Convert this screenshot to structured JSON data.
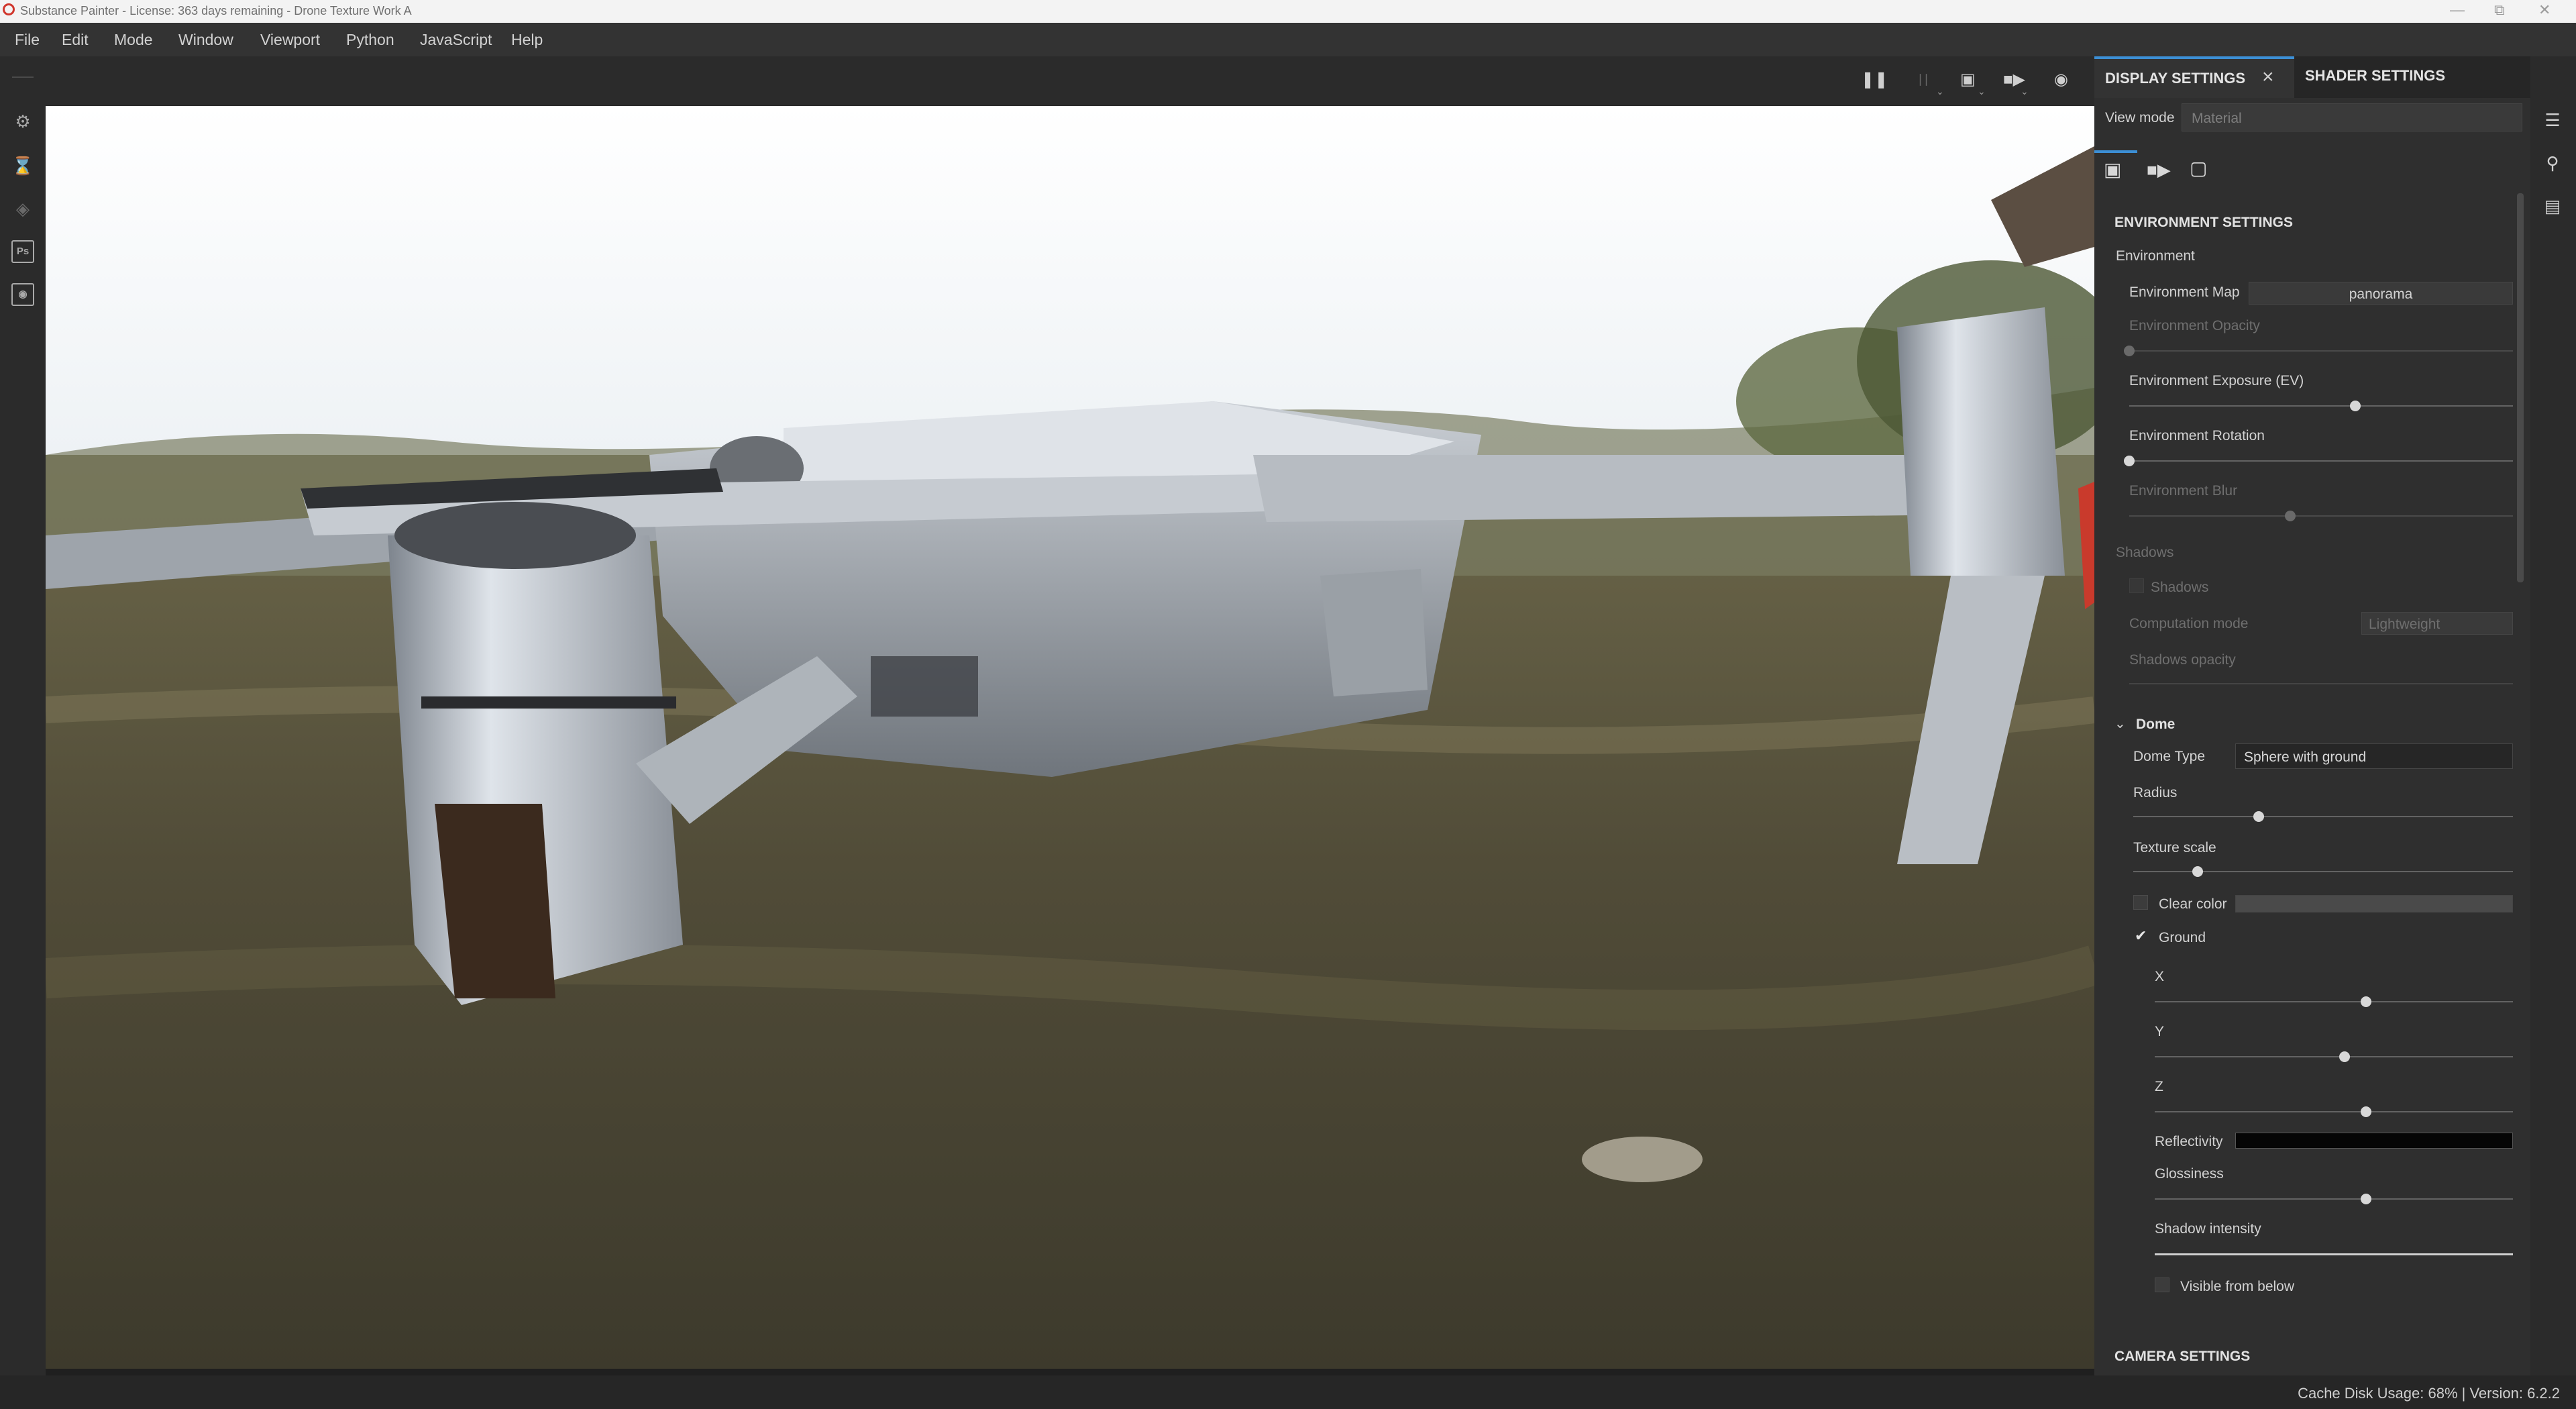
{
  "window": {
    "title": "Substance Painter - License: 363 days remaining - Drone Texture Work A"
  },
  "menu": [
    "File",
    "Edit",
    "Mode",
    "Window",
    "Viewport",
    "Python",
    "JavaScript",
    "Help"
  ],
  "viewport_toolbar": {
    "icons": [
      "pause-icon",
      "symmetry-icon",
      "cube-icon",
      "camera-icon",
      "screenshot-icon"
    ]
  },
  "left_toolbar": {
    "icons": [
      "settings-icon",
      "hourglass-icon",
      "layers-icon",
      "photoshop-icon",
      "export-icon"
    ],
    "ps_label": "Ps"
  },
  "panel": {
    "tabs": {
      "active": "DISPLAY SETTINGS",
      "inactive": "SHADER SETTINGS"
    },
    "view_mode_label": "View mode",
    "view_mode_value": "Material",
    "subtabs": [
      "image-icon",
      "video-icon",
      "frame-icon"
    ],
    "environment": {
      "section_title": "ENVIRONMENT SETTINGS",
      "group_label": "Environment",
      "map_label": "Environment Map",
      "map_value": "panorama",
      "opacity_label": "Environment Opacity",
      "opacity_value": 0.0,
      "exposure_label": "Environment Exposure (EV)",
      "exposure_value": 0.59,
      "rotation_label": "Environment Rotation",
      "rotation_value": 0.0,
      "blur_label": "Environment Blur",
      "blur_value": 0.42
    },
    "shadows": {
      "group_label": "Shadows",
      "checkbox_label": "Shadows",
      "computation_label": "Computation mode",
      "computation_value": "Lightweight",
      "opacity_label": "Shadows opacity"
    },
    "dome": {
      "title": "Dome",
      "type_label": "Dome Type",
      "type_value": "Sphere with ground",
      "radius_label": "Radius",
      "radius_value": 0.33,
      "texture_scale_label": "Texture scale",
      "texture_scale_value": 0.17,
      "clear_color_label": "Clear color",
      "ground_label": "Ground",
      "x_label": "X",
      "x_value": 0.59,
      "y_label": "Y",
      "y_value": 0.53,
      "z_label": "Z",
      "z_value": 0.59,
      "reflectivity_label": "Reflectivity",
      "glossiness_label": "Glossiness",
      "glossiness_value": 0.59,
      "shadow_intensity_label": "Shadow intensity",
      "shadow_intensity_value": 1.0,
      "visible_below_label": "Visible from below"
    },
    "camera_section_title": "CAMERA SETTINGS"
  },
  "right_toolbar": {
    "icons": [
      "layers-stack-icon",
      "zoom-icon",
      "document-icon"
    ]
  },
  "status": {
    "text": "Cache Disk Usage: 68% | Version: 6.2.2"
  },
  "colors": {
    "accent": "#3c8fd5",
    "panel_bg": "#2f2f2f",
    "toolbar_bg": "#2b2b2b"
  }
}
